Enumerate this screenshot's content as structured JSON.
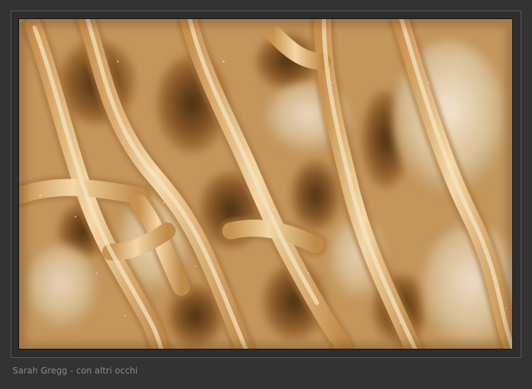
{
  "photo": {
    "subject": "morel-mushroom-macro",
    "colors": {
      "background": "#333333",
      "ridge": "#e8c48d",
      "ridge_highlight": "#f6dfb5",
      "pit_shadow": "#5a3a18",
      "pit_mid": "#b8864a",
      "pale_flesh": "#efe0c8"
    }
  },
  "caption": {
    "text": "Sarah Gregg - con altri occhi"
  }
}
